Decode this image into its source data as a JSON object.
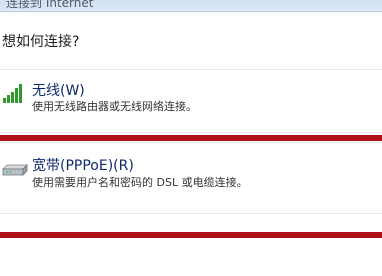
{
  "window": {
    "title": "连接到 Internet"
  },
  "heading": "想如何连接?",
  "options": [
    {
      "label": "无线(W)",
      "description": "使用无线路由器或无线网络连接。",
      "icon": "wireless-signal-icon"
    },
    {
      "label": "宽带(PPPoE)(R)",
      "description": "使用需要用户名和密码的 DSL 或电缆连接。",
      "icon": "broadband-modem-icon"
    }
  ],
  "colors": {
    "highlight_line": "#b0101a",
    "option_label": "#0e2a6e",
    "signal_green": "#2e9a2e"
  }
}
